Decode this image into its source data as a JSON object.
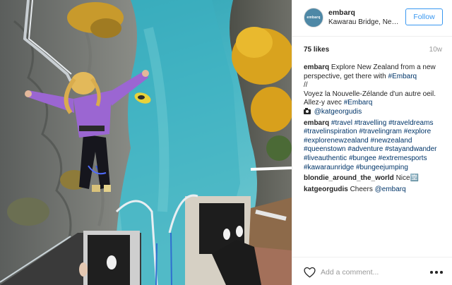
{
  "post": {
    "username": "embarq",
    "avatar_text": "embarq",
    "location": "Kawarau Bridge, New Zealand",
    "follow_label": "Follow",
    "likes": "75 likes",
    "time_ago": "10w"
  },
  "caption": {
    "username": "embarq",
    "line1_text": "Explore New Zealand from a new perspective, get there with",
    "line1_tag": "#Embarq",
    "separator": "//",
    "line2_text": "Voyez la Nouvelle-Zélande d'un autre oeil. Allez-y avec",
    "line2_tag": "#Embarq",
    "credit_mention": "@katgeorgudis"
  },
  "hashtag_comment": {
    "username": "embarq",
    "tags": [
      "#travel",
      "#travelling",
      "#traveldreams",
      "#travelinspiration",
      "#travelingram",
      "#explore",
      "#explorenewzealand",
      "#newzealand",
      "#queenstown",
      "#adventure",
      "#stayandwander",
      "#liveauthentic",
      "#bungee",
      "#extremesports",
      "#kawaraunridge",
      "#bungeejumping"
    ]
  },
  "comments": [
    {
      "username": "blondie_around_the_world",
      "text": "Nice",
      "emoji": "🈳"
    },
    {
      "username": "katgeorgudis",
      "text": "Cheers",
      "mention": "@embarq"
    }
  ],
  "comment_box": {
    "placeholder": "Add a comment..."
  },
  "icons": {
    "like": "heart-outline-icon",
    "more": "more-options-icon",
    "camera": "camera-icon"
  },
  "colors": {
    "follow_blue": "#3897f0",
    "hashtag_blue": "#003569",
    "secondary_text": "#999999",
    "divider": "#efefef"
  }
}
